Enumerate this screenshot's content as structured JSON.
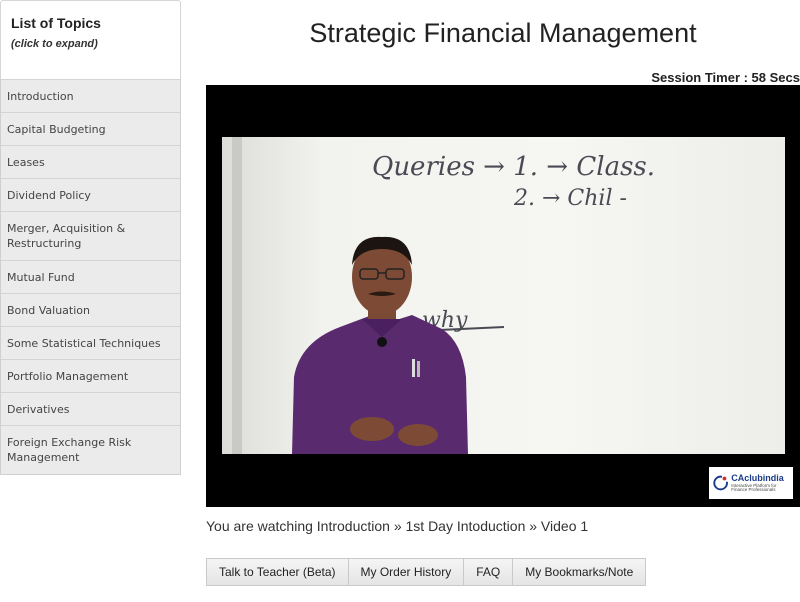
{
  "sidebar": {
    "title": "List of Topics",
    "subtitle": "(click to expand)",
    "topics": [
      "Introduction",
      "Capital Budgeting",
      "Leases",
      "Dividend Policy",
      "Merger, Acquisition & Restructuring",
      "Mutual Fund",
      "Bond Valuation",
      "Some Statistical Techniques",
      "Portfolio Management",
      "Derivatives",
      "Foreign Exchange Risk Management"
    ]
  },
  "header": {
    "title": "Strategic Financial Management",
    "timer": "Session Timer : 58 Secs"
  },
  "video": {
    "whiteboard_lines": [
      "Queries → 1. → Class.",
      "2. → Chil -",
      "why"
    ],
    "logo_name": "CAclubindia",
    "logo_tagline": "Interactive Platform for Finance Professionals",
    "shirt_color": "#5a2a6e"
  },
  "breadcrumb": "You are watching Introduction » 1st Day Intoduction » Video 1",
  "buttons": {
    "talk": "Talk to Teacher (Beta)",
    "orders": "My Order History",
    "faq": "FAQ",
    "bookmarks": "My Bookmarks/Note"
  }
}
